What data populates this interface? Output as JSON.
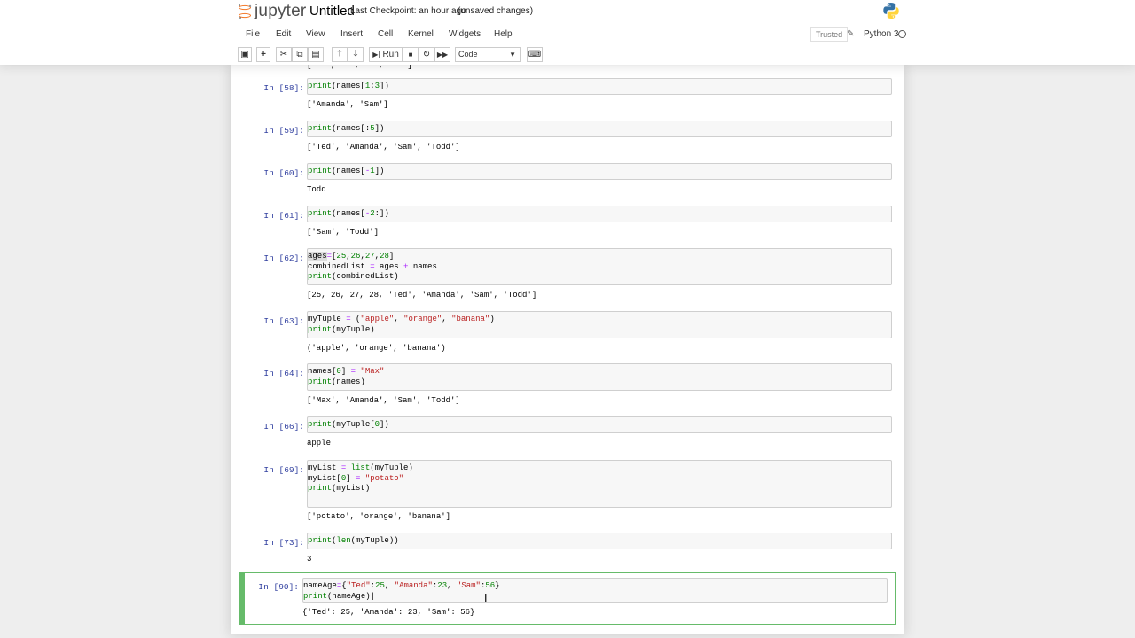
{
  "header": {
    "logo_text": "jupyter",
    "notebook_name": "Untitled",
    "checkpoint": "Last Checkpoint: an hour ago",
    "autosave": "(unsaved changes)"
  },
  "menubar": {
    "items": [
      "File",
      "Edit",
      "View",
      "Insert",
      "Cell",
      "Kernel",
      "Widgets",
      "Help"
    ],
    "trusted": "Trusted",
    "kernel": "Python 3"
  },
  "toolbar": {
    "run_label": "Run",
    "cell_type": "Code"
  },
  "cells": [
    {
      "prompt": "In [58]:",
      "code": [
        "print(names[1:3])"
      ],
      "output": [
        "['Amanda', 'Sam']"
      ]
    },
    {
      "prompt": "In [59]:",
      "code": [
        "print(names[:5])"
      ],
      "output": [
        "['Ted', 'Amanda', 'Sam', 'Todd']"
      ]
    },
    {
      "prompt": "In [60]:",
      "code": [
        "print(names[-1])"
      ],
      "output": [
        "Todd"
      ]
    },
    {
      "prompt": "In [61]:",
      "code": [
        "print(names[-2:])"
      ],
      "output": [
        "['Sam', 'Todd']"
      ]
    },
    {
      "prompt": "In [62]:",
      "code": [
        "ages=[25,26,27,28]",
        "combinedList = ages + names",
        "print(combinedList)"
      ],
      "output": [
        "[25, 26, 27, 28, 'Ted', 'Amanda', 'Sam', 'Todd']"
      ]
    },
    {
      "prompt": "In [63]:",
      "code": [
        "myTuple = (\"apple\", \"orange\", \"banana\")",
        "print(myTuple)"
      ],
      "output": [
        "('apple', 'orange', 'banana')"
      ]
    },
    {
      "prompt": "In [64]:",
      "code": [
        "names[0] = \"Max\"",
        "print(names)"
      ],
      "output": [
        "['Max', 'Amanda', 'Sam', 'Todd']"
      ]
    },
    {
      "prompt": "In [66]:",
      "code": [
        "print(myTuple[0])"
      ],
      "output": [
        "apple"
      ]
    },
    {
      "prompt": "In [69]:",
      "code": [
        "myList = list(myTuple)",
        "myList[0] = \"potato\"",
        "print(myList)"
      ],
      "output": [
        "['potato', 'orange', 'banana']"
      ]
    },
    {
      "prompt": "In [73]:",
      "code": [
        "print(len(myTuple))"
      ],
      "output": [
        "3"
      ]
    },
    {
      "prompt": "In [90]:",
      "code": [
        "nameAge={\"Ted\":25, \"Amanda\":23, \"Sam\":56}",
        "print(nameAge)"
      ],
      "output": [
        "{'Ted': 25, 'Amanda': 23, 'Sam': 56}"
      ]
    }
  ]
}
